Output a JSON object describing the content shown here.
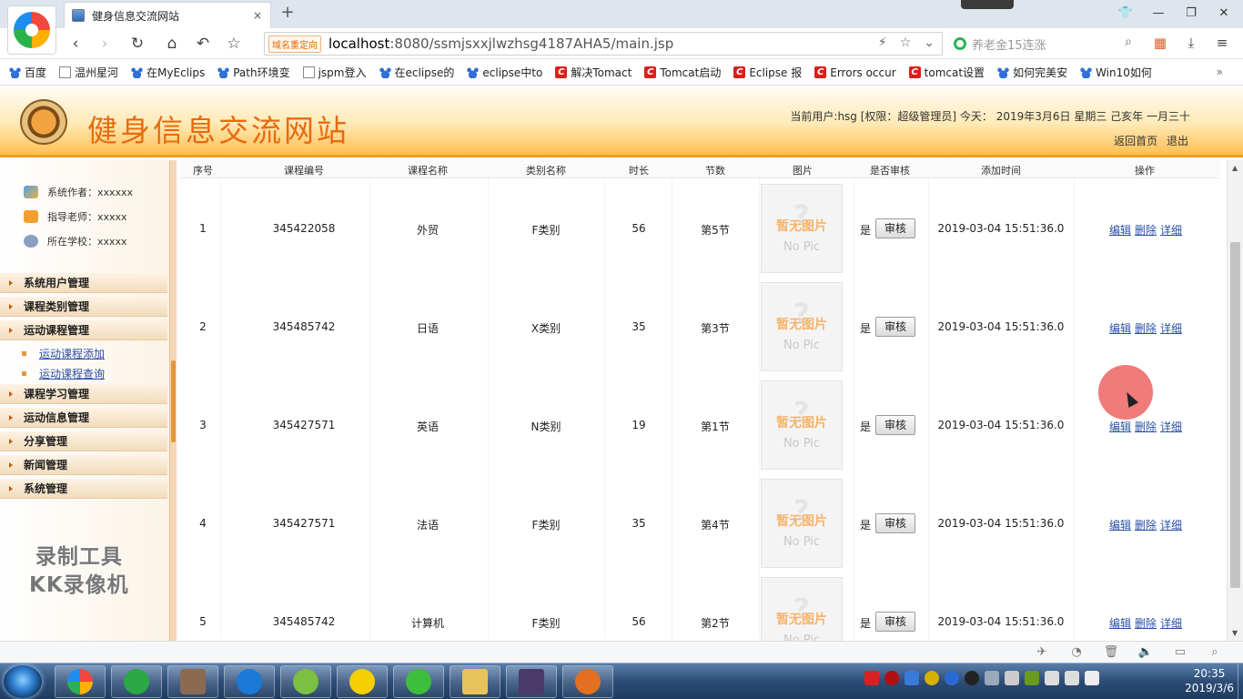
{
  "browser": {
    "tab_title": "健身信息交流网站",
    "new_tab_symbol": "+",
    "close_symbol": "×",
    "redirect_tag": "域名重定向",
    "url_host": "localhost",
    "url_rest": ":8080/ssmjsxxjlwzhsg4187AHA5/main.jsp",
    "search_placeholder": "养老金15连涨",
    "bookmarks": [
      "百度",
      "温州星河",
      "在MyEclips",
      "Path环境变",
      "jspm登入",
      "在eclipse的",
      "eclipse中to",
      "解决Tomact",
      "Tomcat启动",
      "Eclipse 报",
      "Errors occur",
      "tomcat设置",
      "如何完美安",
      "Win10如何"
    ]
  },
  "site": {
    "title": "健身信息交流网站",
    "userinfo": "当前用户:hsg [权限：超级管理员] 今天： 2019年3月6日 星期三 己亥年 一月三十",
    "link_home": "返回首页",
    "link_logout": "退出"
  },
  "sidebar": {
    "info": [
      "系统作者：xxxxxx",
      "指导老师：xxxxx",
      "所在学校：xxxxx"
    ],
    "menus": [
      "系统用户管理",
      "课程类别管理",
      "运动课程管理",
      "课程学习管理",
      "运动信息管理",
      "分享管理",
      "新闻管理",
      "系统管理"
    ],
    "submenus": [
      "运动课程添加",
      "运动课程查询"
    ],
    "watermark_line1": "录制工具",
    "watermark_line2": "KK录像机"
  },
  "table": {
    "headers": [
      "序号",
      "课程编号",
      "课程名称",
      "类别名称",
      "时长",
      "节数",
      "图片",
      "是否审核",
      "添加时间",
      "操作"
    ],
    "rows": [
      {
        "no": "1",
        "code": "345422058",
        "name": "外贸",
        "category": "F类别",
        "duration": "56",
        "section": "第5节",
        "audited": "是",
        "time": "2019-03-04 15:51:36.0"
      },
      {
        "no": "2",
        "code": "345485742",
        "name": "日语",
        "category": "X类别",
        "duration": "35",
        "section": "第3节",
        "audited": "是",
        "time": "2019-03-04 15:51:36.0"
      },
      {
        "no": "3",
        "code": "345427571",
        "name": "英语",
        "category": "N类别",
        "duration": "19",
        "section": "第1节",
        "audited": "是",
        "time": "2019-03-04 15:51:36.0"
      },
      {
        "no": "4",
        "code": "345427571",
        "name": "法语",
        "category": "F类别",
        "duration": "35",
        "section": "第4节",
        "audited": "是",
        "time": "2019-03-04 15:51:36.0"
      },
      {
        "no": "5",
        "code": "345485742",
        "name": "计算机",
        "category": "F类别",
        "duration": "56",
        "section": "第2节",
        "audited": "是",
        "time": "2019-03-04 15:51:36.0"
      }
    ],
    "audit_button": "审核",
    "op_edit": "编辑",
    "op_delete": "删除",
    "op_detail": "详细",
    "pic_placeholder_cn": "暂无图片",
    "pic_placeholder_en": "No Pic",
    "pic_placeholder_mark": "?"
  },
  "taskbar": {
    "time": "20:35",
    "date": "2019/3/6"
  },
  "colors": {
    "site_title": "#e66b0d",
    "link": "#2a4fa5",
    "header_stripe": "#f39a1e"
  }
}
